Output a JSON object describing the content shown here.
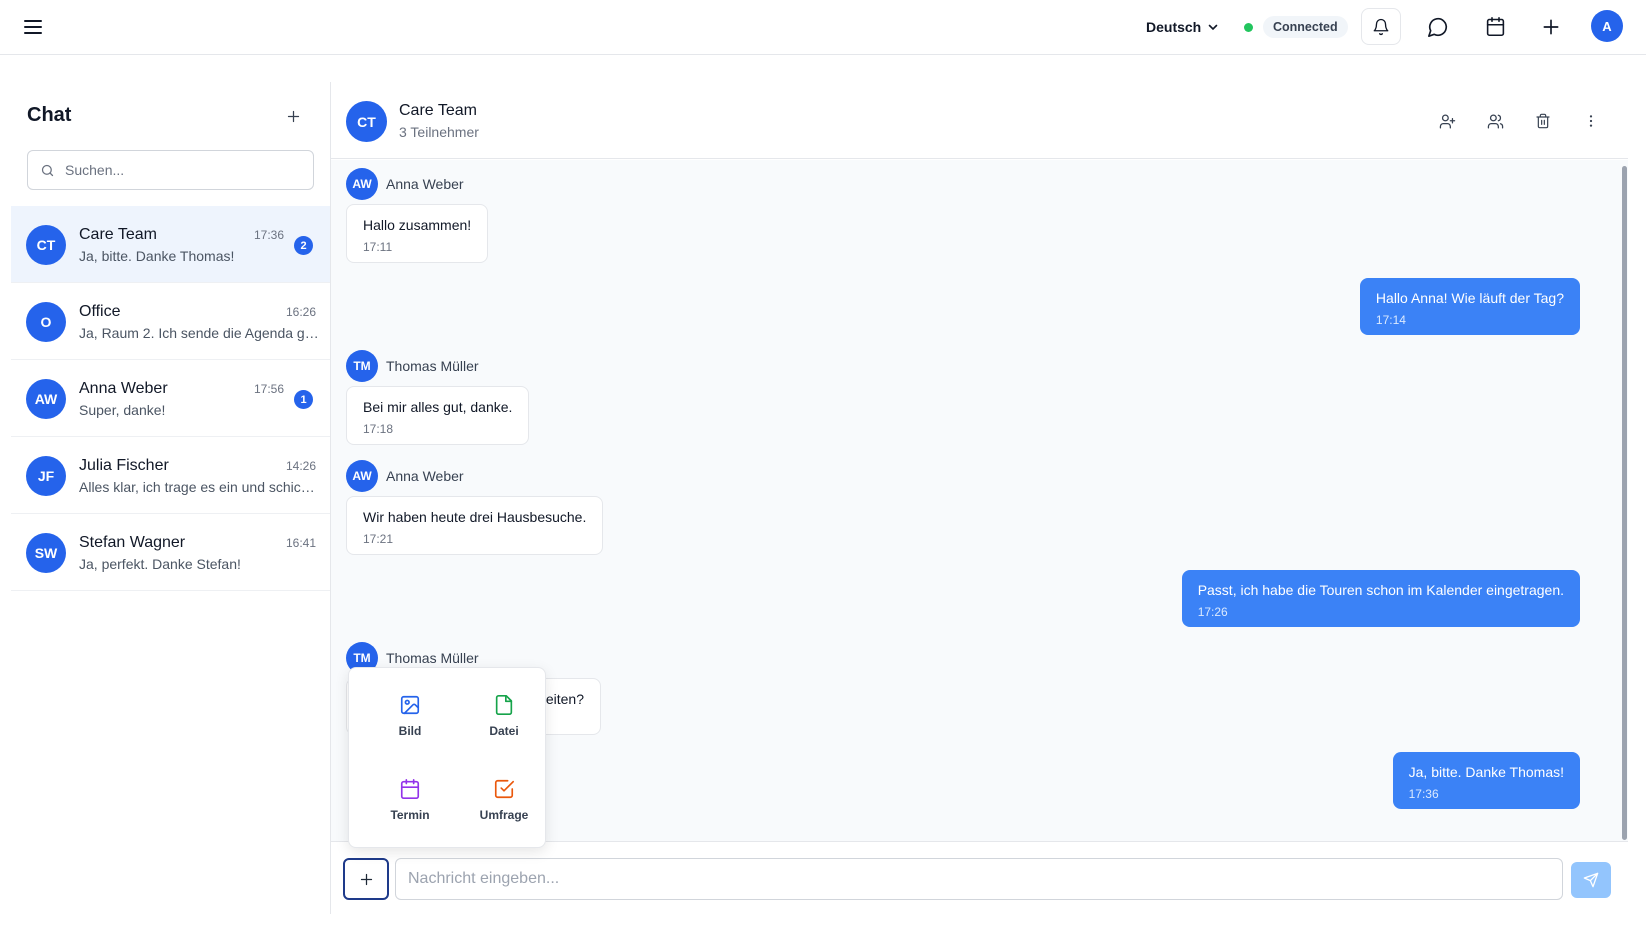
{
  "topbar": {
    "language": "Deutsch",
    "connection_status": "Connected",
    "user_initial": "A",
    "status_color": "#22c55e",
    "accent_color": "#2563eb"
  },
  "sidebar": {
    "title": "Chat",
    "search_placeholder": "Suchen...",
    "conversations": [
      {
        "initials": "CT",
        "name": "Care Team",
        "preview": "Ja, bitte. Danke Thomas!",
        "time": "17:36",
        "unread": "2",
        "active": true
      },
      {
        "initials": "O",
        "name": "Office",
        "preview": "Ja, Raum 2. Ich sende die Agenda gl...",
        "time": "16:26",
        "unread": "",
        "active": false
      },
      {
        "initials": "AW",
        "name": "Anna Weber",
        "preview": "Super, danke!",
        "time": "17:56",
        "unread": "1",
        "active": false
      },
      {
        "initials": "JF",
        "name": "Julia Fischer",
        "preview": "Alles klar, ich trage es ein und schick...",
        "time": "14:26",
        "unread": "",
        "active": false
      },
      {
        "initials": "SW",
        "name": "Stefan Wagner",
        "preview": "Ja, perfekt. Danke Stefan!",
        "time": "16:41",
        "unread": "",
        "active": false
      }
    ]
  },
  "chat": {
    "initials": "CT",
    "name": "Care Team",
    "participants": "3 Teilnehmer",
    "messages": [
      {
        "direction": "in",
        "sender_initials": "AW",
        "sender": "Anna Weber",
        "text": "Hallo zusammen!",
        "time": "17:11"
      },
      {
        "direction": "out",
        "text": "Hallo Anna! Wie läuft der Tag?",
        "time": "17:14"
      },
      {
        "direction": "in",
        "sender_initials": "TM",
        "sender": "Thomas Müller",
        "text": "Bei mir alles gut, danke.",
        "time": "17:18"
      },
      {
        "direction": "in",
        "sender_initials": "AW",
        "sender": "Anna Weber",
        "text": "Wir haben heute drei Hausbesuche.",
        "time": "17:21"
      },
      {
        "direction": "out",
        "text": "Passt, ich habe die Touren schon im Kalender eingetragen.",
        "time": "17:26"
      },
      {
        "direction": "in",
        "sender_initials": "TM",
        "sender": "Thomas Müller",
        "text": "eiten?",
        "time": ""
      },
      {
        "direction": "out",
        "text": "Ja, bitte. Danke Thomas!",
        "time": "17:36"
      }
    ]
  },
  "composer": {
    "placeholder": "Nachricht eingeben..."
  },
  "attach_menu": {
    "items": [
      {
        "label": "Bild",
        "icon": "image-icon",
        "color": "#2563eb"
      },
      {
        "label": "Datei",
        "icon": "file-icon",
        "color": "#16a34a"
      },
      {
        "label": "Termin",
        "icon": "calendar-icon",
        "color": "#9333ea"
      },
      {
        "label": "Umfrage",
        "icon": "poll-check-icon",
        "color": "#ea580c"
      }
    ]
  }
}
